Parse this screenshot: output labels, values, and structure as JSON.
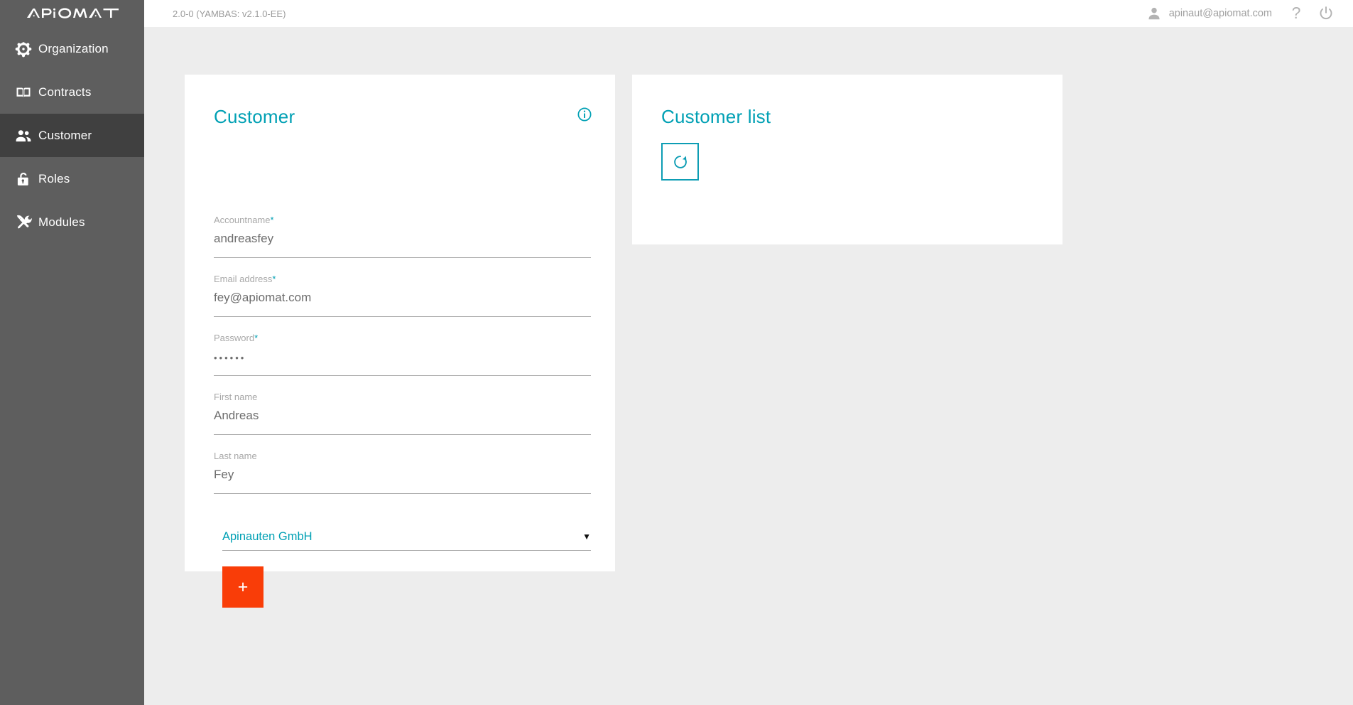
{
  "brand": {
    "logo_text": "APIOMAT",
    "logo_icon": "apiomat-logo"
  },
  "topbar": {
    "version_text": "2.0-0 (YAMBAS: v2.1.0-EE)",
    "user_email": "apinaut@apiomat.com",
    "user_icon": "person-icon",
    "help_icon": "question-mark-icon",
    "power_icon": "power-icon"
  },
  "sidebar": {
    "items": [
      {
        "label": "Organization",
        "icon": "network-hub-icon",
        "active": false
      },
      {
        "label": "Contracts",
        "icon": "open-book-icon",
        "active": false
      },
      {
        "label": "Customer",
        "icon": "people-icon",
        "active": true
      },
      {
        "label": "Roles",
        "icon": "lock-icon",
        "active": false
      },
      {
        "label": "Modules",
        "icon": "hammer-wrench-icon",
        "active": false
      }
    ]
  },
  "customer_card": {
    "title": "Customer",
    "info_icon": "info-circle-icon",
    "fields": [
      {
        "label": "Accountname",
        "required": true,
        "value": "andreasfey",
        "placeholder": "",
        "type": "text",
        "name": "accountname"
      },
      {
        "label": "Email address",
        "required": true,
        "value": "fey@apiomat.com",
        "placeholder": "",
        "type": "text",
        "name": "email-address"
      },
      {
        "label": "Password",
        "required": true,
        "value": "••••••",
        "placeholder": "",
        "type": "password",
        "name": "password"
      },
      {
        "label": "First name",
        "required": false,
        "value": "Andreas",
        "placeholder": "",
        "type": "text",
        "name": "first-name"
      },
      {
        "label": "Last name",
        "required": false,
        "value": "Fey",
        "placeholder": "",
        "type": "text",
        "name": "last-name"
      }
    ],
    "organization_select": {
      "selected": "Apinauten GmbH",
      "caret": "▼"
    },
    "add_button_label": "+"
  },
  "customer_list_card": {
    "title": "Customer list",
    "refresh_icon": "refresh-circular-arrow-icon",
    "rows": []
  },
  "colors": {
    "accent_cyan": "#00a0b4",
    "accent_orange": "#f93d08",
    "sidebar_bg": "#5e5e5e",
    "sidebar_active_bg": "#404040",
    "page_bg": "#ededed",
    "card_bg": "#ffffff",
    "label_gray": "#a8a8a8",
    "value_gray": "#6d6d6d",
    "refresh_border": "#0d9db4"
  }
}
